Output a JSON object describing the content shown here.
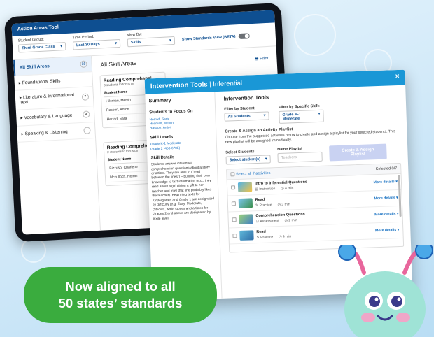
{
  "tablet": {
    "title": "Action Areas Tool",
    "filters": {
      "student_group": {
        "label": "Student Group:",
        "value": "Third Grade Class"
      },
      "time_period": {
        "label": "Time Period:",
        "value": "Last 30 Days"
      },
      "view_by": {
        "label": "View By:",
        "value": "Skills"
      },
      "standards_toggle": {
        "label": "Show Standards View (BETA)"
      }
    },
    "sidebar": [
      {
        "label": "All Skill Areas",
        "count": "10"
      },
      {
        "label": "Foundational Skills",
        "count": ""
      },
      {
        "label": "Literature & Informational Text",
        "count": "7"
      },
      {
        "label": "Vocabulary & Language",
        "count": "4"
      },
      {
        "label": "Speaking & Listening",
        "count": "1"
      }
    ],
    "main_title": "All Skill Areas",
    "print_label": "Print",
    "cards": [
      {
        "title": "Reading Comprehensi",
        "sub": "3 students to focus on",
        "header": "Student Name",
        "rows": [
          "Hileman, Melvin",
          "Rascon, Anton",
          "Herrod, Sara"
        ]
      },
      {
        "title": "Reading Comprehensi",
        "sub": "2 students to focus on",
        "header": "Student Name",
        "rows": [
          "Bizzuso, Charlene",
          "Mcculloch, Homer"
        ]
      }
    ]
  },
  "modal": {
    "title_bold": "Intervention Tools",
    "title_sep": " | ",
    "title_thin": "Inferential",
    "close": "×",
    "summary": {
      "heading": "Summary",
      "focus_heading": "Students to Focus On",
      "focus_students": [
        "Herrod, Sara",
        "Hileman, Melvin",
        "Rascon, Anton"
      ],
      "skill_levels_heading": "Skill Levels",
      "skill_levels": [
        "Grade K-1 Moderate",
        "Grade 2 (450-670L)"
      ],
      "skill_details_heading": "Skill Details",
      "skill_details": "Students answer inferential comprehension questions about a story or article. They are able to (\"read between the lines\") – building their own knowledge to text information (e.g., they read about a girl giving a gift to her teacher and infer that she probably likes the teacher). Beginning texts for Kindergarten and Grade 1 are designated by difficulty (e.g. Easy, Moderate, Difficult), while stories and articles for Grades 2 and above are designated by lexile level."
    },
    "heading": "Intervention Tools",
    "filter_student": {
      "label": "Filter by Student:",
      "value": "All Students"
    },
    "filter_skill": {
      "label": "Filter by Specific Skill:",
      "value": "Grade K-1 Moderate"
    },
    "create_heading": "Create & Assign an Activity Playlist",
    "create_text": "Choose from the suggested activities below to create and assign a playlist for your selected students. This new playlist will be assigned immediately.",
    "select_students": {
      "label": "Select Students",
      "value": "Select student(s)"
    },
    "name_playlist": {
      "label": "Name Playlist",
      "placeholder": "Teachers"
    },
    "create_button": "Create & Assign Playlist",
    "select_all": "Select all 7 activities",
    "selected": "Selected 0/7",
    "activities": [
      {
        "title": "Intro to Inferential Questions",
        "type": "Instruction",
        "time": "4 min",
        "more": "More details ▾"
      },
      {
        "title": "Read",
        "type": "Practice",
        "time": "3 min",
        "more": "More details ▾"
      },
      {
        "title": "Comprehension Questions",
        "type": "Assessment",
        "time": "2 min",
        "more": "More details ▾"
      },
      {
        "title": "Read",
        "type": "Practice",
        "time": "4 min",
        "more": "More details ▾"
      }
    ]
  },
  "badge": {
    "line1": "Now aligned to all",
    "line2": "50 states’ standards"
  },
  "colors": {
    "navy": "#0e4f91",
    "sky": "#1a97d6",
    "green": "#3aac3e",
    "char_body": "#9fe3d6",
    "char_pink": "#e8669c"
  }
}
